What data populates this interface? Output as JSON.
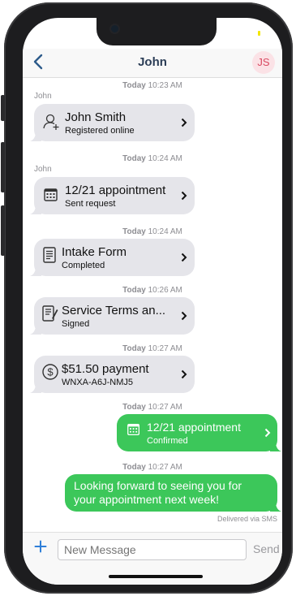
{
  "header": {
    "title": "John",
    "avatar_initials": "JS"
  },
  "messages": [
    {
      "timestamp_day": "Today",
      "timestamp_time": "10:23 AM",
      "sender": "John",
      "title": "John Smith",
      "subtitle": "Registered online",
      "icon": "add-user-icon"
    },
    {
      "timestamp_day": "Today",
      "timestamp_time": "10:24 AM",
      "sender": "John",
      "title": "12/21 appointment",
      "subtitle": "Sent request",
      "icon": "calendar-icon"
    },
    {
      "timestamp_day": "Today",
      "timestamp_time": "10:24 AM",
      "title": "Intake Form",
      "subtitle": "Completed",
      "icon": "form-icon"
    },
    {
      "timestamp_day": "Today",
      "timestamp_time": "10:26 AM",
      "title": "Service Terms an...",
      "subtitle": "Signed",
      "icon": "signed-document-icon"
    },
    {
      "timestamp_day": "Today",
      "timestamp_time": "10:27 AM",
      "title": "$51.50 payment",
      "subtitle": "WNXA-A6J-NMJ5",
      "icon": "dollar-icon"
    },
    {
      "timestamp_day": "Today",
      "timestamp_time": "10:27 AM",
      "title": "12/21 appointment",
      "subtitle": "Confirmed",
      "icon": "calendar-icon",
      "outgoing": true
    },
    {
      "timestamp_day": "Today",
      "timestamp_time": "10:27 AM",
      "text_line1": "Looking forward to seeing you for",
      "text_line2": "your appointment next week!",
      "outgoing": true
    }
  ],
  "delivered_label": "Delivered via SMS",
  "composer": {
    "placeholder": "New Message",
    "send_label": "Send"
  },
  "colors": {
    "incoming_bubble": "#e5e5ea",
    "outgoing_bubble": "#3cc75a",
    "back_blue": "#2c5a8a",
    "avatar_bg": "#fbe2e6"
  }
}
